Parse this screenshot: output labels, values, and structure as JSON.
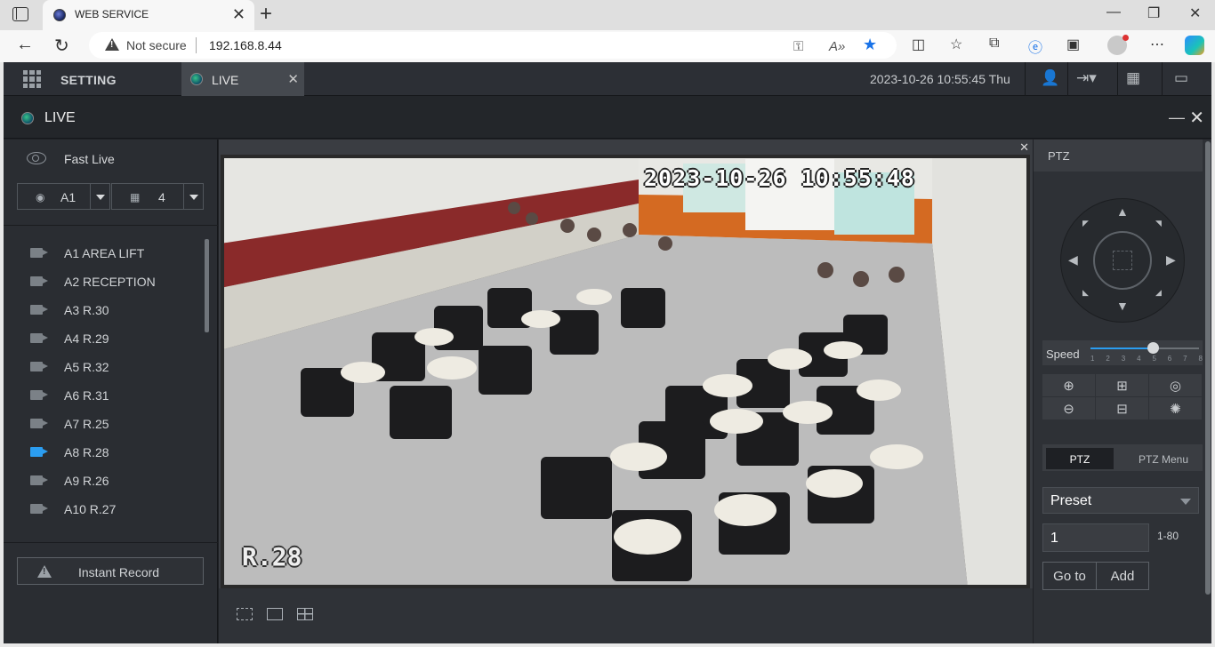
{
  "browser": {
    "tab_title": "WEB SERVICE",
    "security_label": "Not secure",
    "url": "192.168.8.44"
  },
  "app": {
    "nav": {
      "setting_label": "SETTING",
      "live_tab_label": "LIVE",
      "datetime": "2023-10-26 10:55:45 Thu"
    },
    "window": {
      "title": "LIVE"
    },
    "left": {
      "fast_live_label": "Fast Live",
      "area_select_value": "A1",
      "split_select_value": "4",
      "cameras": [
        {
          "label": "A1 AREA LIFT",
          "active": false
        },
        {
          "label": "A2 RECEPTION",
          "active": false
        },
        {
          "label": "A3 R.30",
          "active": false
        },
        {
          "label": "A4 R.29",
          "active": false
        },
        {
          "label": "A5 R.32",
          "active": false
        },
        {
          "label": "A6 R.31",
          "active": false
        },
        {
          "label": "A7 R.25",
          "active": false
        },
        {
          "label": "A8 R.28",
          "active": true
        },
        {
          "label": "A9 R.26",
          "active": false
        },
        {
          "label": "A10 R.27",
          "active": false
        }
      ],
      "instant_record_label": "Instant Record"
    },
    "video": {
      "osd_timestamp": "2023-10-26 10:55:48",
      "osd_channel": "R.28"
    },
    "ptz": {
      "header": "PTZ",
      "speed_label": "Speed",
      "speed_value": 5,
      "speed_ticks": [
        "1",
        "2",
        "3",
        "4",
        "5",
        "6",
        "7",
        "8"
      ],
      "tab_ptz": "PTZ",
      "tab_menu": "PTZ Menu",
      "preset_label": "Preset",
      "preset_value": "1",
      "preset_range": "1-80",
      "goto_label": "Go to",
      "add_label": "Add"
    }
  },
  "colors": {
    "accent": "#2b9df0",
    "app_bg": "#1f2125",
    "panel_bg": "#2a2d32"
  }
}
